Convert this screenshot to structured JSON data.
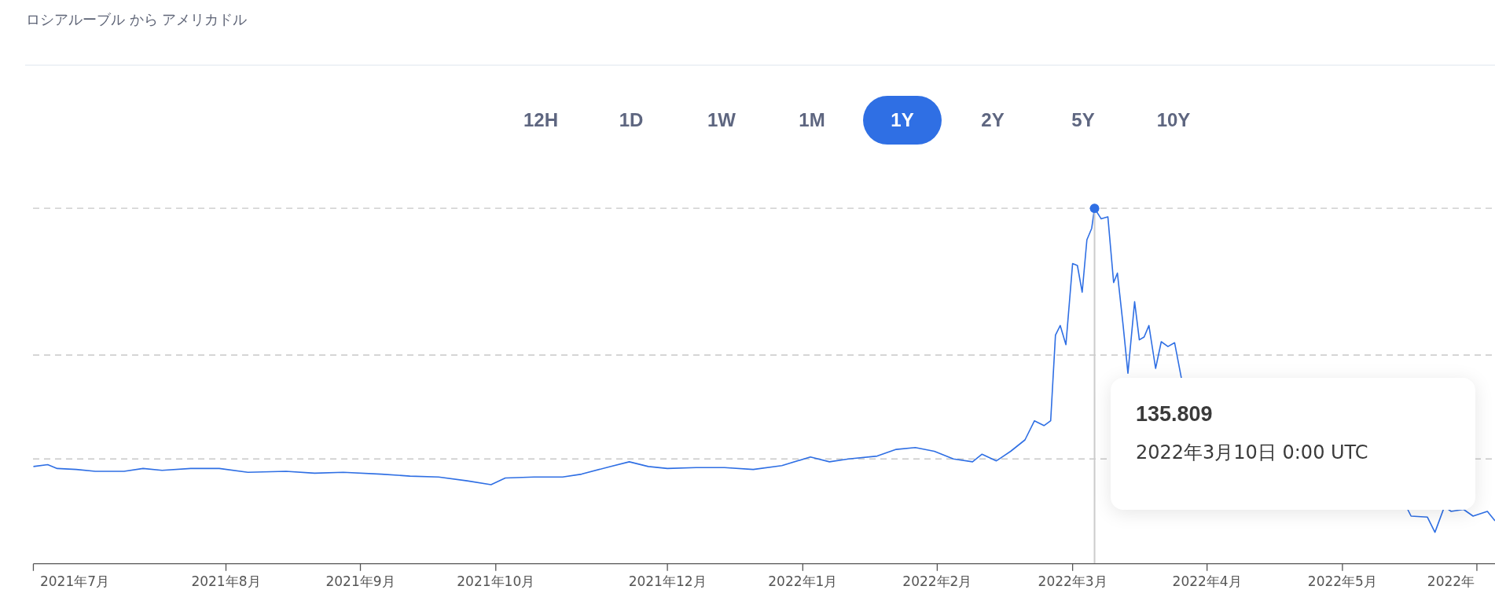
{
  "title": "ロシアルーブル から アメリカドル",
  "ranges": [
    {
      "label": "12H",
      "selected": false
    },
    {
      "label": "1D",
      "selected": false
    },
    {
      "label": "1W",
      "selected": false
    },
    {
      "label": "1M",
      "selected": false
    },
    {
      "label": "1Y",
      "selected": true
    },
    {
      "label": "2Y",
      "selected": false
    },
    {
      "label": "5Y",
      "selected": false
    },
    {
      "label": "10Y",
      "selected": false
    }
  ],
  "chart": {
    "x_axis_labels": [
      "2021年7月",
      "2021年8月",
      "2021年9月",
      "2021年10月",
      "2021年12月",
      "2022年1月",
      "2022年2月",
      "2022年3月",
      "2022年4月",
      "2022年5月",
      "2022年"
    ],
    "tooltip": {
      "value": "135.809",
      "date": "2022年3月10日 0:00 UTC"
    }
  }
}
